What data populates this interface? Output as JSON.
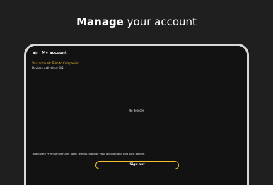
{
  "headline": {
    "strong": "Manage",
    "rest": "your account"
  },
  "appbar": {
    "title": "My account",
    "back_icon": "back-arrow-icon"
  },
  "account": {
    "account_text": "Your account: Telmito Companion",
    "devices_text": "Devices activated: 0/1"
  },
  "empty_state": "No devices",
  "hint": "To activate Premium version, open Telmito, log into your account and add your device.",
  "sign_out_label": "Sign out",
  "colors": {
    "background": "#1f1f1f",
    "screen": "#121212",
    "accent": "#f2c230",
    "device_frame": "#d9d9d9"
  }
}
